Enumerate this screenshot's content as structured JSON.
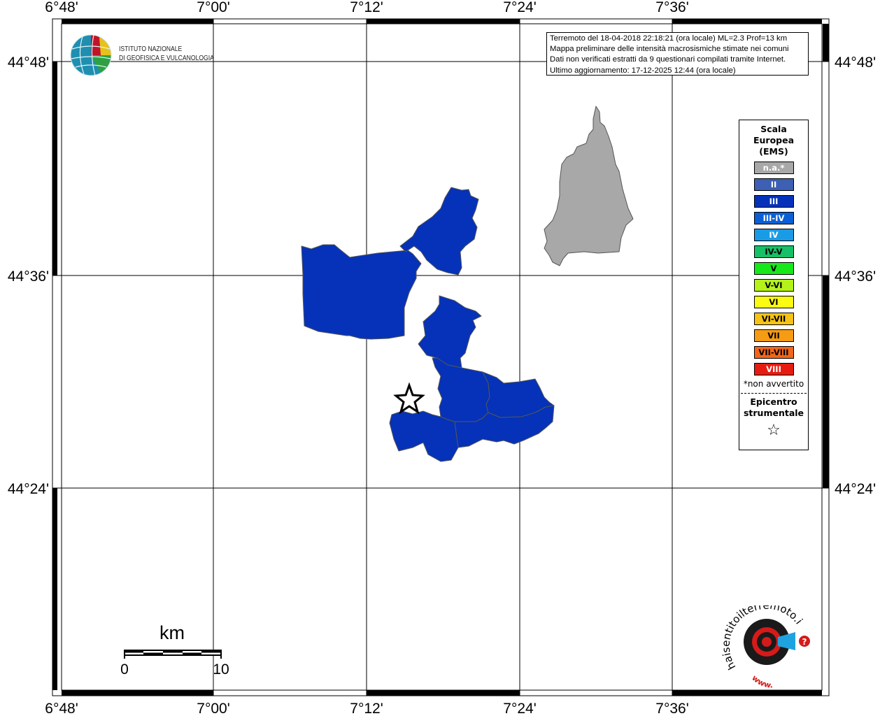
{
  "map": {
    "lon_labels": [
      "6°48'",
      "7°00'",
      "7°12'",
      "7°24'",
      "7°36'"
    ],
    "lat_labels": [
      "44°48'",
      "44°36'",
      "44°24'"
    ],
    "colors": {
      "intensity_III": "#0532b8",
      "not_felt": "#a8a8a8",
      "border": "#555555",
      "grid": "#000000"
    }
  },
  "logo_ingv": {
    "line1": "ISTITUTO NAZIONALE",
    "line2": "DI GEOFISICA E VULCANOLOGIA",
    "icon": "globe-icon"
  },
  "info_box": {
    "line1": "Terremoto del 18-04-2018 22:18:21 (ora locale) ML=2.3 Prof=13 km",
    "line2": "Mappa preliminare delle intensità macrosismiche stimate nei comuni",
    "line3": "Dati non verificati estratti da 9 questionari compilati tramite Internet.",
    "line4": "Ultimo aggiornamento: 17-12-2025 12:44 (ora locale)"
  },
  "legend": {
    "title1": "Scala",
    "title2": "Europea",
    "title3": "(EMS)",
    "items": [
      {
        "label": "n.a.*",
        "color": "#a8a8a8",
        "text_color": "#ffffff"
      },
      {
        "label": "II",
        "color": "#3d5fb4",
        "text_color": "#ffffff"
      },
      {
        "label": "III",
        "color": "#0532b8",
        "text_color": "#ffffff"
      },
      {
        "label": "III-IV",
        "color": "#0a5fd6",
        "text_color": "#ffffff"
      },
      {
        "label": "IV",
        "color": "#1a9be6",
        "text_color": "#ffffff"
      },
      {
        "label": "IV-V",
        "color": "#17c067",
        "text_color": "#000000"
      },
      {
        "label": "V",
        "color": "#17e81a",
        "text_color": "#000000"
      },
      {
        "label": "V-VI",
        "color": "#b4f21a",
        "text_color": "#000000"
      },
      {
        "label": "VI",
        "color": "#fafa12",
        "text_color": "#000000"
      },
      {
        "label": "VI-VII",
        "color": "#f5c215",
        "text_color": "#000000"
      },
      {
        "label": "VII",
        "color": "#f59b14",
        "text_color": "#000000"
      },
      {
        "label": "VII-VIII",
        "color": "#f2661a",
        "text_color": "#000000"
      },
      {
        "label": "VIII",
        "color": "#e61c12",
        "text_color": "#ffffff"
      }
    ],
    "note": "*non avvertito",
    "epicentre1": "Epicentro",
    "epicentre2": "strumentale",
    "epicentre_icon": "star-icon"
  },
  "scale_bar": {
    "unit": "km",
    "min_label": "0",
    "max_label": "10"
  },
  "hsit_logo": {
    "text": "haisentitoilterremoto.it",
    "url_text": "www.",
    "icon": "target-icon"
  }
}
